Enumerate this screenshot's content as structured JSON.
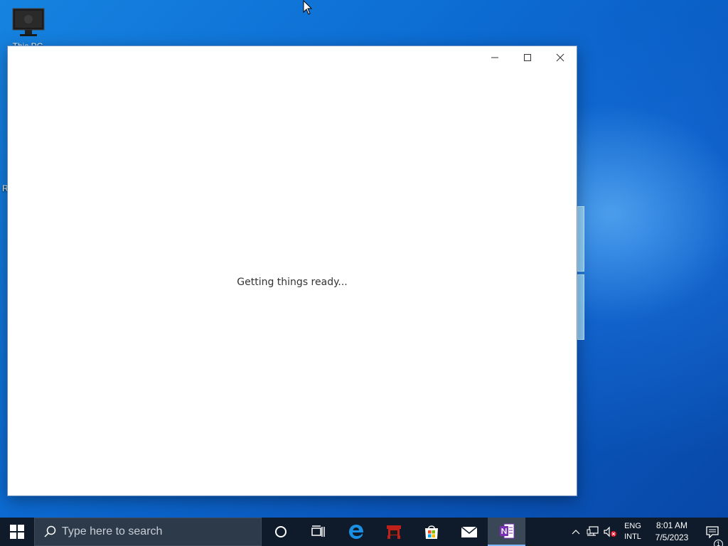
{
  "desktop": {
    "icons": [
      {
        "label": "This PC"
      }
    ]
  },
  "app_window": {
    "status_text": "Getting things ready...",
    "controls": {
      "minimize": "minimize",
      "maximize": "maximize",
      "close": "close"
    }
  },
  "taskbar": {
    "search_placeholder": "Type here to search",
    "pinned": [
      {
        "name": "Cortana",
        "icon": "circle-icon"
      },
      {
        "name": "Task View",
        "icon": "task-view-icon"
      },
      {
        "name": "Microsoft Edge",
        "icon": "edge-icon"
      },
      {
        "name": "Application",
        "icon": "red-app-icon"
      },
      {
        "name": "Microsoft Store",
        "icon": "store-icon"
      },
      {
        "name": "Mail",
        "icon": "mail-icon"
      },
      {
        "name": "OneNote",
        "icon": "onenote-icon",
        "active": true
      }
    ],
    "tray": {
      "language_line1": "ENG",
      "language_line2": "INTL",
      "time": "8:01 AM",
      "date": "7/5/2023",
      "notification_count": "1"
    }
  },
  "colors": {
    "taskbar_bg": "#0f1b2a",
    "onenote_purple": "#7b2fb5",
    "edge_blue": "#1a8fe3",
    "app_red": "#c0201a"
  }
}
